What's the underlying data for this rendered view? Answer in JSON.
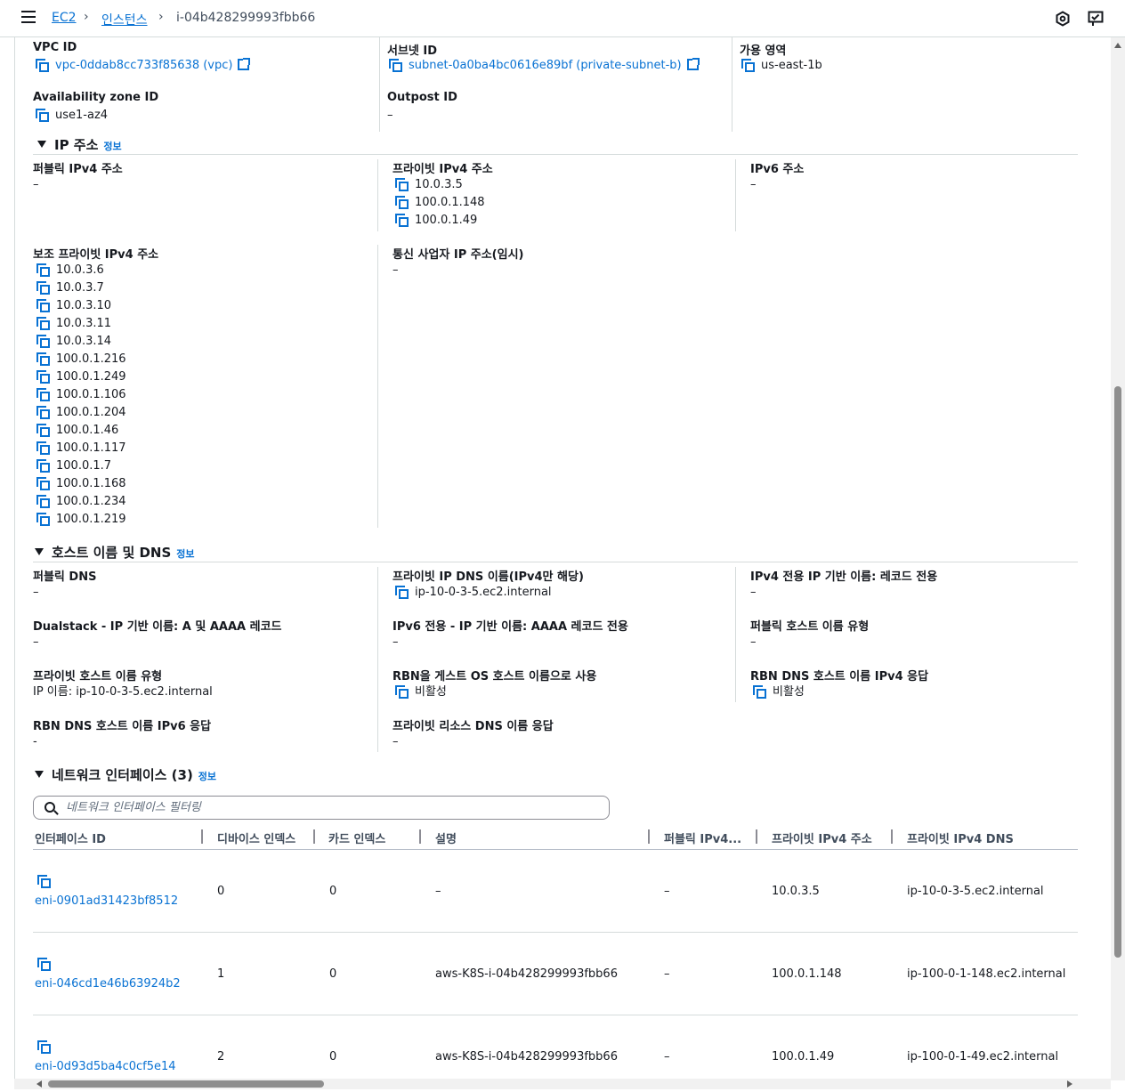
{
  "breadcrumb": {
    "ec2": "EC2",
    "instances": "인스턴스",
    "current": "i-04b428299993fbb66"
  },
  "details": {
    "vpc_id_label": "VPC ID",
    "vpc_id_value": "vpc-0ddab8cc733f85638 (vpc)",
    "subnet_id_label": "서브넷 ID",
    "subnet_id_value": "subnet-0a0ba4bc0616e89bf (private-subnet-b)",
    "az_label": "가용 영역",
    "az_value": "us-east-1b",
    "az_id_label": "Availability zone ID",
    "az_id_value": "use1-az4",
    "outpost_label": "Outpost ID",
    "outpost_value": "–"
  },
  "ip_section": {
    "title": "IP 주소",
    "info": "정보",
    "public_ipv4_label": "퍼블릭 IPv4 주소",
    "public_ipv4_value": "–",
    "private_ipv4_label": "프라이빗 IPv4 주소",
    "private_ipv4_values": [
      "10.0.3.5",
      "100.0.1.148",
      "100.0.1.49"
    ],
    "ipv6_label": "IPv6 주소",
    "ipv6_value": "–",
    "secondary_label": "보조 프라이빗 IPv4 주소",
    "secondary_values": [
      "10.0.3.6",
      "10.0.3.7",
      "10.0.3.10",
      "10.0.3.11",
      "10.0.3.14",
      "100.0.1.216",
      "100.0.1.249",
      "100.0.1.106",
      "100.0.1.204",
      "100.0.1.46",
      "100.0.1.117",
      "100.0.1.7",
      "100.0.1.168",
      "100.0.1.234",
      "100.0.1.219"
    ],
    "carrier_label": "통신 사업자 IP 주소(임시)",
    "carrier_value": "–"
  },
  "dns_section": {
    "title": "호스트 이름 및 DNS",
    "info": "정보",
    "public_dns_label": "퍼블릭 DNS",
    "public_dns_value": "–",
    "private_ip_dns_label": "프라이빗 IP DNS 이름(IPv4만 해당)",
    "private_ip_dns_value": "ip-10-0-3-5.ec2.internal",
    "ipv4_only_label": "IPv4 전용 IP 기반 이름: 레코드 전용",
    "ipv4_only_value": "–",
    "dualstack_label": "Dualstack - IP 기반 이름: A 및 AAAA 레코드",
    "dualstack_value": "–",
    "ipv6_only_label": "IPv6 전용 - IP 기반 이름: AAAA 레코드 전용",
    "ipv6_only_value": "–",
    "public_host_type_label": "퍼블릭 호스트 이름 유형",
    "public_host_type_value": "–",
    "private_host_type_label": "프라이빗 호스트 이름 유형",
    "private_host_type_value": "IP 이름: ip-10-0-3-5.ec2.internal",
    "rbn_guest_label": "RBN을 게스트 OS 호스트 이름으로 사용",
    "rbn_guest_value": "비활성",
    "rbn_ipv4_label": "RBN DNS 호스트 이름 IPv4 응답",
    "rbn_ipv4_value": "비활성",
    "rbn_ipv6_label": "RBN DNS 호스트 이름 IPv6 응답",
    "rbn_ipv6_value": "-",
    "private_resource_label": "프라이빗 리소스 DNS 이름 응답",
    "private_resource_value": "–"
  },
  "eni_section": {
    "title": "네트워크 인터페이스 (3)",
    "info": "정보",
    "filter_placeholder": "네트워크 인터페이스 필터링",
    "columns": [
      "인터페이스 ID",
      "디바이스 인덱스",
      "카드 인덱스",
      "설명",
      "퍼블릭 IPv4...",
      "프라이빗 IPv4 주소",
      "프라이빗 IPv4 DNS"
    ],
    "rows": [
      {
        "id": "eni-0901ad31423bf8512",
        "device": "0",
        "card": "0",
        "desc": "–",
        "public": "–",
        "private": "10.0.3.5",
        "dns": "ip-10-0-3-5.ec2.internal"
      },
      {
        "id": "eni-046cd1e46b63924b2",
        "device": "1",
        "card": "0",
        "desc": "aws-K8S-i-04b428299993fbb66",
        "public": "–",
        "private": "100.0.1.148",
        "dns": "ip-100-0-1-148.ec2.internal"
      },
      {
        "id": "eni-0d93d5ba4c0cf5e14",
        "device": "2",
        "card": "0",
        "desc": "aws-K8S-i-04b428299993fbb66",
        "public": "–",
        "private": "100.0.1.49",
        "dns": "ip-100-0-1-49.ec2.internal"
      }
    ]
  }
}
